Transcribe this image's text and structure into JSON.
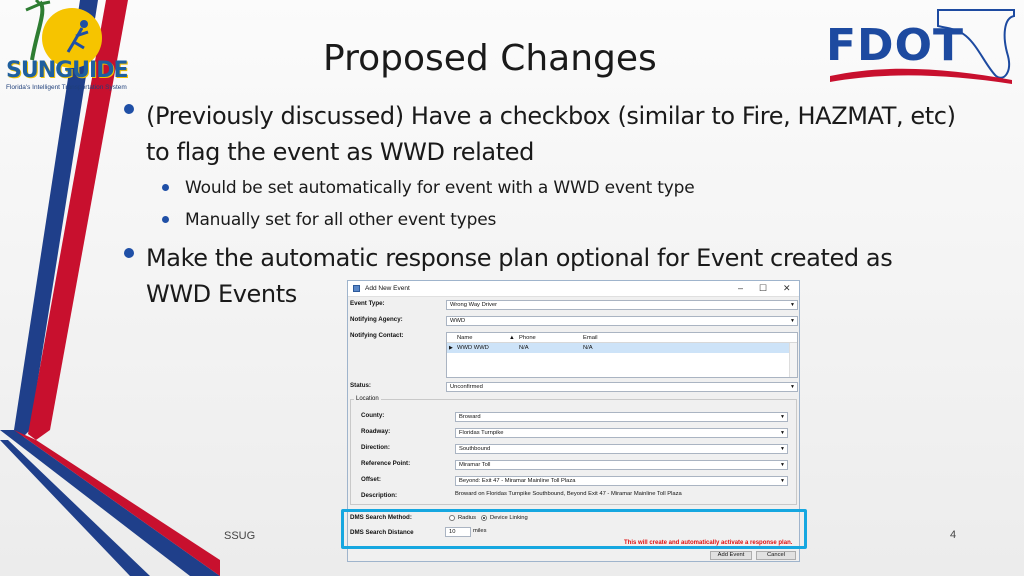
{
  "logos": {
    "sunguide_word": "SUNGUIDE",
    "sunguide_tagline": "Florida's Intelligent Transportation System",
    "fdot_word": "FDOT"
  },
  "slide": {
    "title": "Proposed Changes",
    "bullets": [
      {
        "text": "(Previously discussed) Have a checkbox (similar to Fire, HAZMAT, etc) to flag the event as WWD related",
        "sub": [
          "Would be set automatically for event with a WWD event type",
          "Manually set for all other event types"
        ]
      },
      {
        "text": "Make the automatic response plan optional for Event created as WWD Events"
      }
    ],
    "footer_left": "SSUG",
    "page_number": "4"
  },
  "dialog": {
    "title": "Add New Event",
    "controls": {
      "minimize": "–",
      "maximize": "☐",
      "close": "✕"
    },
    "event_type_label": "Event Type:",
    "event_type_value": "Wrong Way Driver",
    "notifying_agency_label": "Notifying Agency:",
    "notifying_agency_value": "WWD",
    "notifying_contact_label": "Notifying Contact:",
    "contacts_columns": [
      "Name",
      "Phone",
      "Email"
    ],
    "contacts_rows": [
      {
        "name": "WWD WWD",
        "phone": "N/A",
        "email": "N/A"
      }
    ],
    "status_label": "Status:",
    "status_value": "Unconfirmed",
    "location_group": "Location",
    "county_label": "County:",
    "county_value": "Broward",
    "roadway_label": "Roadway:",
    "roadway_value": "Floridas Turnpike",
    "direction_label": "Direction:",
    "direction_value": "Southbound",
    "reference_point_label": "Reference Point:",
    "reference_point_value": "Miramar Toll",
    "offset_label": "Offset:",
    "offset_value": "Beyond: Exit 47 - Miramar Mainline Toll Plaza",
    "description_label": "Description:",
    "description_value": "Broward on Floridas Turnpike Southbound, Beyond Exit 47 - Miramar Mainline Toll Plaza",
    "dms_method_label": "DMS Search Method:",
    "dms_method_options": [
      "Radius",
      "Device Linking"
    ],
    "dms_method_selected": "Device Linking",
    "dms_distance_label": "DMS Search Distance",
    "dms_distance_value": "10",
    "dms_distance_unit": "miles",
    "warning_text": "This will create and automatically activate a response plan.",
    "add_event_button": "Add Event",
    "cancel_button": "Cancel"
  },
  "colors": {
    "bullet": "#1f4fa6",
    "highlight_box": "#16a7e0",
    "warning": "#e01010",
    "stripe_red": "#c8102e",
    "stripe_blue": "#1f3f8a"
  }
}
